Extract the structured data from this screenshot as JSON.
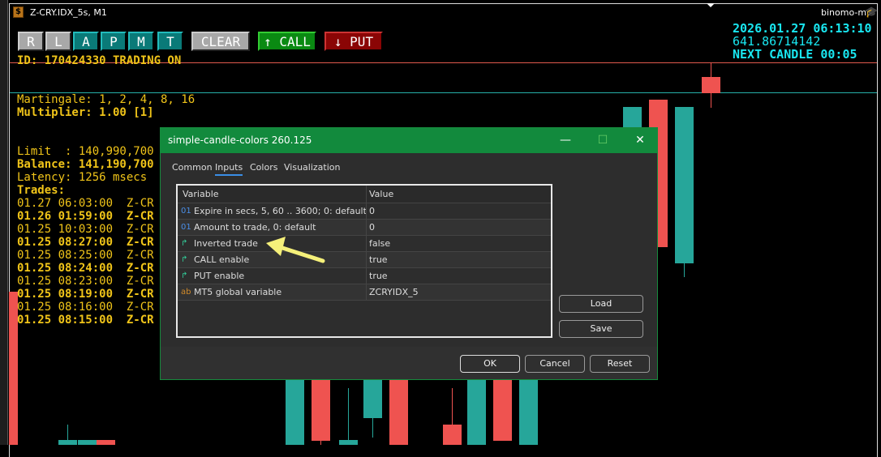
{
  "window": {
    "title": "Z-CRY.IDX_5s, M1",
    "account": "binomo-mt5"
  },
  "toolbar": {
    "buttons": [
      "R",
      "L",
      "A",
      "P",
      "M",
      "T"
    ],
    "clear": "CLEAR",
    "call": "↑ CALL",
    "put": "↓ PUT"
  },
  "status": {
    "id_line": "ID: 170424330 TRADING ON",
    "martingale": "Martingale: 1, 2, 4, 8, 16",
    "multiplier": "Multiplier: 1.00 [1]",
    "limit": "Limit  : 140,990,700",
    "balance": "Balance: 141,190,700",
    "latency": "Latency: 1256 msecs",
    "trades_label": "Trades:"
  },
  "trades": [
    "01.27 06:03:00  Z-CR",
    "01.26 01:59:00  Z-CR",
    "01.25 10:03:00  Z-CR",
    "01.25 08:27:00  Z-CR",
    "01.25 08:25:00  Z-CR",
    "01.25 08:24:00  Z-CR",
    "01.25 08:23:00  Z-CR",
    "01.25 08:19:00  Z-CR",
    "01.25 08:16:00  Z-CR",
    "01.25 08:15:00  Z-CR"
  ],
  "info": {
    "datetime": "2026.01.27 06:13:10",
    "price": "641.86714142",
    "next_candle": "NEXT CANDLE 00:05"
  },
  "dialog": {
    "title": "simple-candle-colors 260.125",
    "tabs": [
      "Common",
      "Inputs",
      "Colors",
      "Visualization"
    ],
    "active_tab": "Inputs",
    "columns": [
      "Variable",
      "Value"
    ],
    "rows": [
      {
        "icon": "01",
        "variable": "Expire in secs, 5, 60 .. 3600; 0: default",
        "value": "0"
      },
      {
        "icon": "01",
        "variable": "Amount to trade, 0: default",
        "value": "0"
      },
      {
        "icon": "bool",
        "variable": "Inverted trade",
        "value": "false"
      },
      {
        "icon": "bool",
        "variable": "CALL enable",
        "value": "true"
      },
      {
        "icon": "bool",
        "variable": "PUT enable",
        "value": "true"
      },
      {
        "icon": "ab",
        "variable": "MT5 global variable",
        "value": "ZCRYIDX_5"
      }
    ],
    "load": "Load",
    "save": "Save",
    "ok": "OK",
    "cancel": "Cancel",
    "reset": "Reset",
    "close": "✕",
    "maximize": "☐",
    "minimize": "—"
  },
  "colors": {
    "bull": "#26a69a",
    "bear": "#ef5350",
    "accent": "#128a3d",
    "text_yellow": "#f0c419",
    "text_cyan": "#19e6f0"
  }
}
